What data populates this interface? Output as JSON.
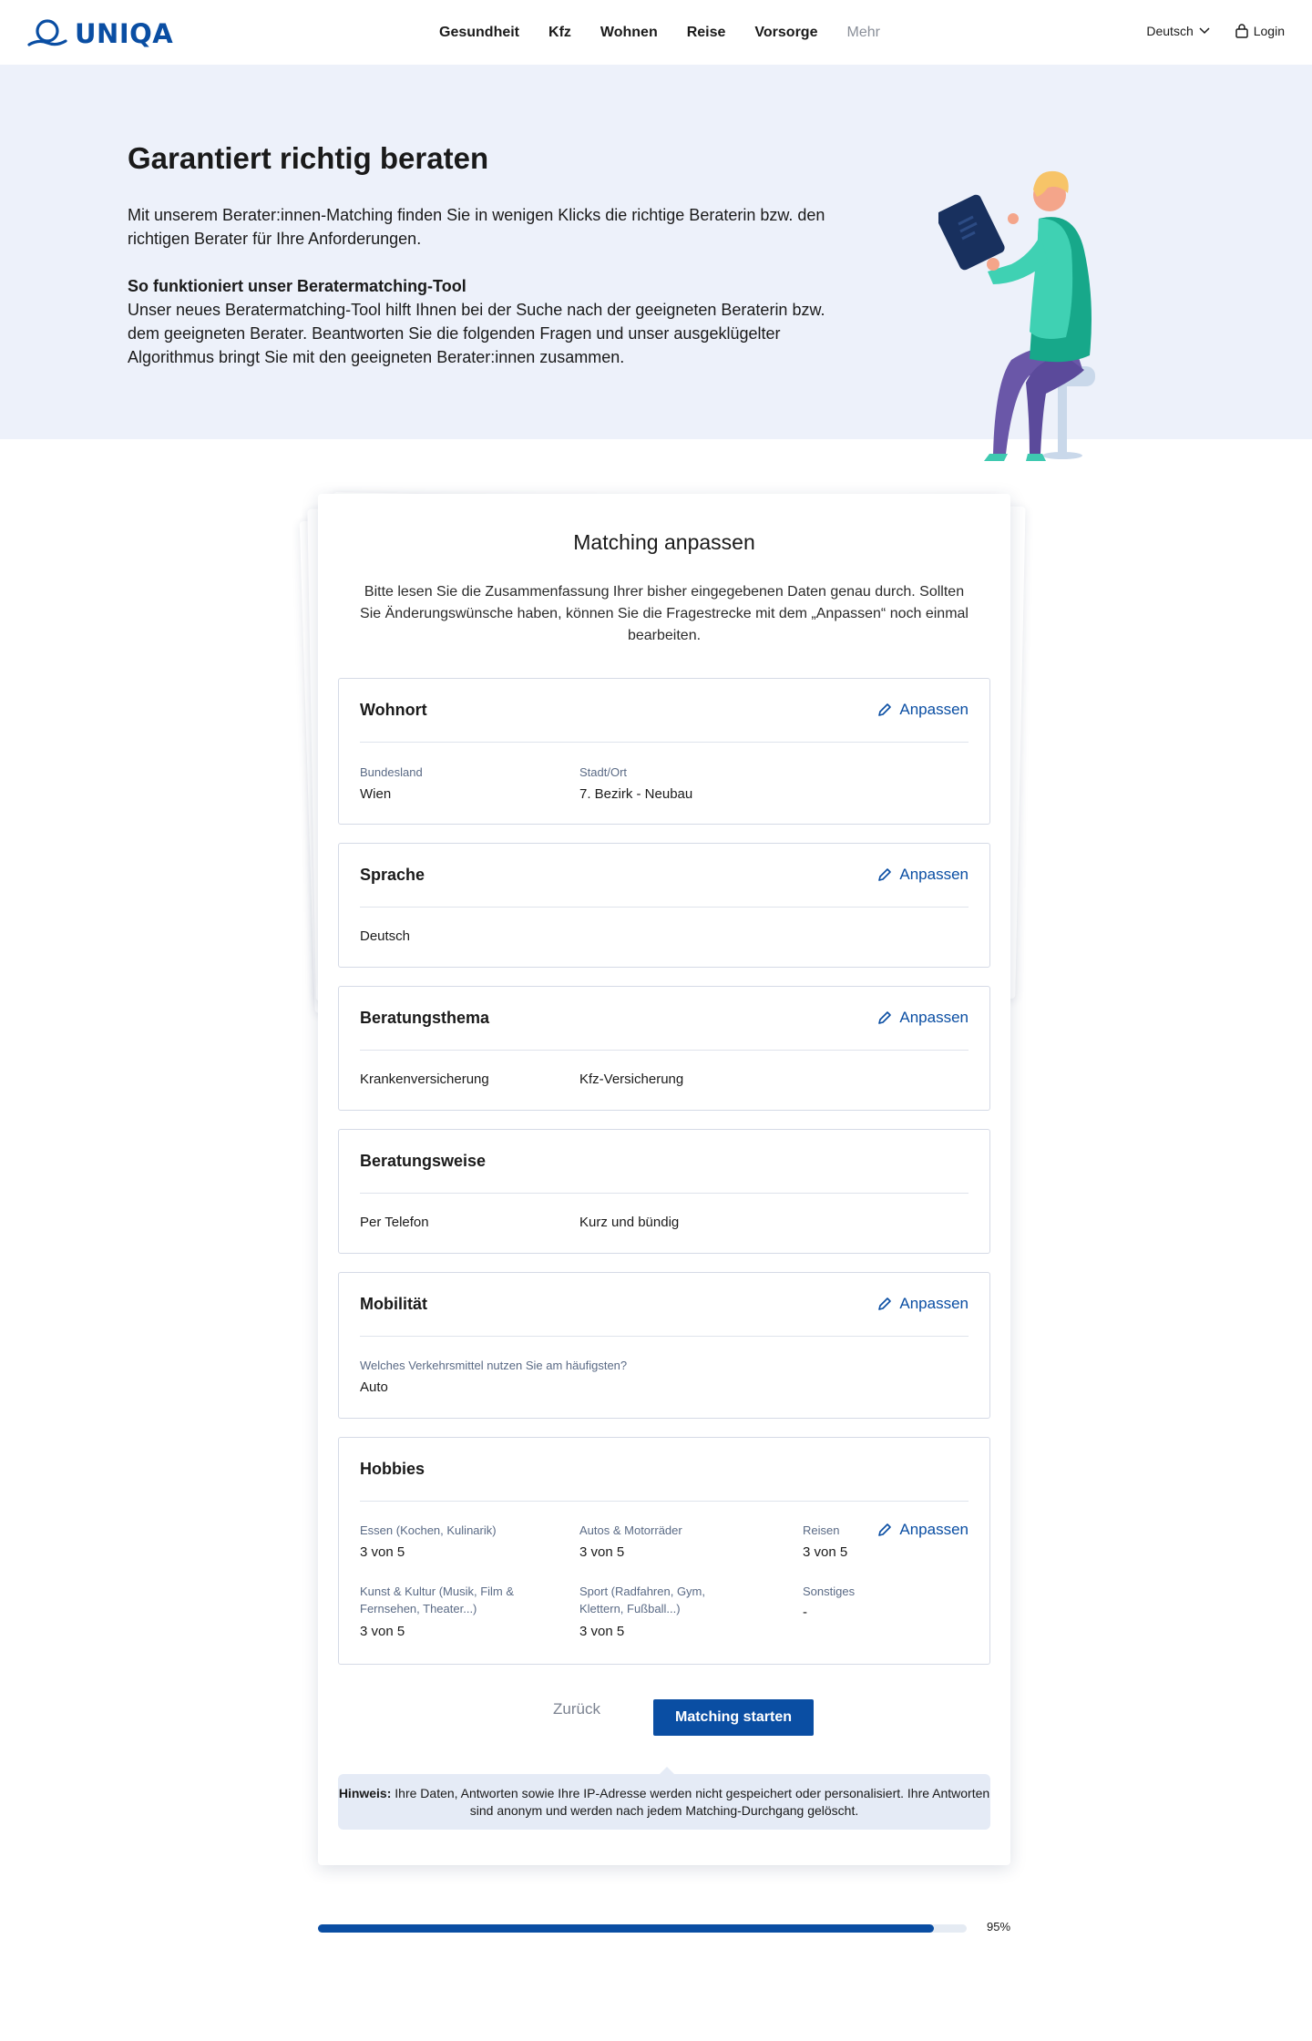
{
  "nav": {
    "brand": "UNIQA",
    "links": [
      "Gesundheit",
      "Kfz",
      "Wohnen",
      "Reise",
      "Vorsorge",
      "Mehr"
    ],
    "language": "Deutsch",
    "login": "Login"
  },
  "hero": {
    "title": "Garantiert richtig beraten",
    "intro": "Mit unserem Berater:innen-Matching finden Sie in wenigen Klicks die richtige Beraterin bzw. den richtigen Berater für Ihre Anforderungen.",
    "subtitle": "So funktioniert unser Beratermatching-Tool",
    "body": "Unser neues Beratermatching-Tool hilft Ihnen bei der Suche nach der geeigneten Beraterin bzw. dem geeigneten Berater. Beantworten Sie die folgenden Fragen und unser ausgeklügelter Algorithmus bringt Sie mit den geeigneten Berater:innen zusammen."
  },
  "card": {
    "title": "Matching anpassen",
    "intro": "Bitte lesen Sie die Zusammenfassung Ihrer bisher eingegebenen Daten genau durch. Sollten Sie Änderungswünsche haben, können Sie die Fragestrecke mit dem „Anpassen“ noch einmal bearbeiten.",
    "edit_label": "Anpassen",
    "wohnort": {
      "title": "Wohnort",
      "bundesland_label": "Bundesland",
      "bundesland_value": "Wien",
      "stadt_label": "Stadt/Ort",
      "stadt_value": "7. Bezirk - Neubau"
    },
    "sprache": {
      "title": "Sprache",
      "value": "Deutsch"
    },
    "thema": {
      "title": "Beratungsthema",
      "value1": "Krankenversicherung",
      "value2": "Kfz-Versicherung"
    },
    "weise": {
      "title": "Beratungsweise",
      "value1": "Per Telefon",
      "value2": "Kurz und bündig"
    },
    "mobil": {
      "title": "Mobilität",
      "question": "Welches Verkehrsmittel nutzen Sie am häufigsten?",
      "value": "Auto"
    },
    "hobbies": {
      "title": "Hobbies",
      "items": [
        {
          "label": "Essen (Kochen, Kulinarik)",
          "value": "3 von 5"
        },
        {
          "label": "Autos & Motorräder",
          "value": "3 von 5"
        },
        {
          "label": "Reisen",
          "value": "3 von 5"
        },
        {
          "label": "Kunst & Kultur (Musik, Film & Fernsehen, Theater...)",
          "value": "3 von 5"
        },
        {
          "label": "Sport (Radfahren, Gym, Klettern, Fußball...)",
          "value": "3 von 5"
        },
        {
          "label": "Sonstiges",
          "value": "-"
        }
      ]
    },
    "back": "Zurück",
    "start": "Matching starten",
    "notice_bold": "Hinweis:",
    "notice_text": " Ihre Daten, Antworten sowie Ihre IP-Adresse werden nicht gespeichert oder personalisiert. Ihre Antworten sind anonym und werden nach jedem Matching-Durchgang gelöscht."
  },
  "progress": {
    "value": 0.95,
    "label": "95%"
  },
  "colors": {
    "brand": "#0a4ea3",
    "hero_bg": "#edf1fa",
    "notice_bg": "#e5ebf6"
  }
}
